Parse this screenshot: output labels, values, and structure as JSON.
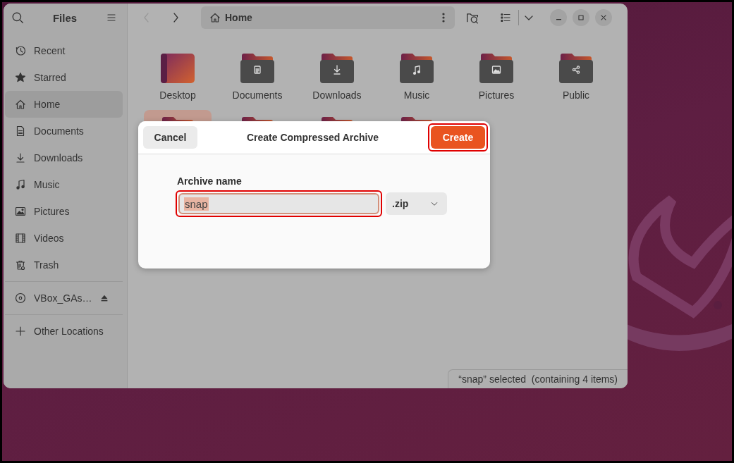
{
  "window": {
    "title": "Files"
  },
  "sidebar": {
    "items": [
      {
        "label": "Recent",
        "kind": "recent",
        "selected": false
      },
      {
        "label": "Starred",
        "kind": "star",
        "selected": false
      },
      {
        "label": "Home",
        "kind": "home",
        "selected": true
      },
      {
        "label": "Documents",
        "kind": "documents",
        "selected": false
      },
      {
        "label": "Downloads",
        "kind": "downloads",
        "selected": false
      },
      {
        "label": "Music",
        "kind": "music",
        "selected": false
      },
      {
        "label": "Pictures",
        "kind": "pictures",
        "selected": false
      },
      {
        "label": "Videos",
        "kind": "videos",
        "selected": false
      },
      {
        "label": "Trash",
        "kind": "trash",
        "selected": false
      }
    ],
    "devices": [
      {
        "label": "VBox_GAs…",
        "kind": "disc",
        "ejectable": true
      }
    ],
    "other": [
      {
        "label": "Other Locations",
        "kind": "plus"
      }
    ]
  },
  "path_bar": {
    "location": "Home"
  },
  "folders": [
    {
      "label": "Desktop",
      "kind": "desktop",
      "selected": false
    },
    {
      "label": "Documents",
      "kind": "documents",
      "selected": false
    },
    {
      "label": "Downloads",
      "kind": "downloads",
      "selected": false
    },
    {
      "label": "Music",
      "kind": "music",
      "selected": false
    },
    {
      "label": "Pictures",
      "kind": "pictures",
      "selected": false
    },
    {
      "label": "Public",
      "kind": "public",
      "selected": false
    },
    {
      "kind": "plain",
      "selected": true
    },
    {
      "kind": "plain",
      "selected": false
    },
    {
      "kind": "plain",
      "selected": false
    },
    {
      "kind": "plain",
      "selected": false
    }
  ],
  "status_bar": "“snap” selected  (containing 4 items)",
  "dialog": {
    "title": "Create Compressed Archive",
    "cancel": {
      "label": "Cancel"
    },
    "create": {
      "label": "Create",
      "highlighted": true
    },
    "field_label": "Archive name",
    "name_field": {
      "value": "snap",
      "text_selected": true,
      "highlighted": true
    },
    "format": {
      "value": ".zip"
    }
  }
}
